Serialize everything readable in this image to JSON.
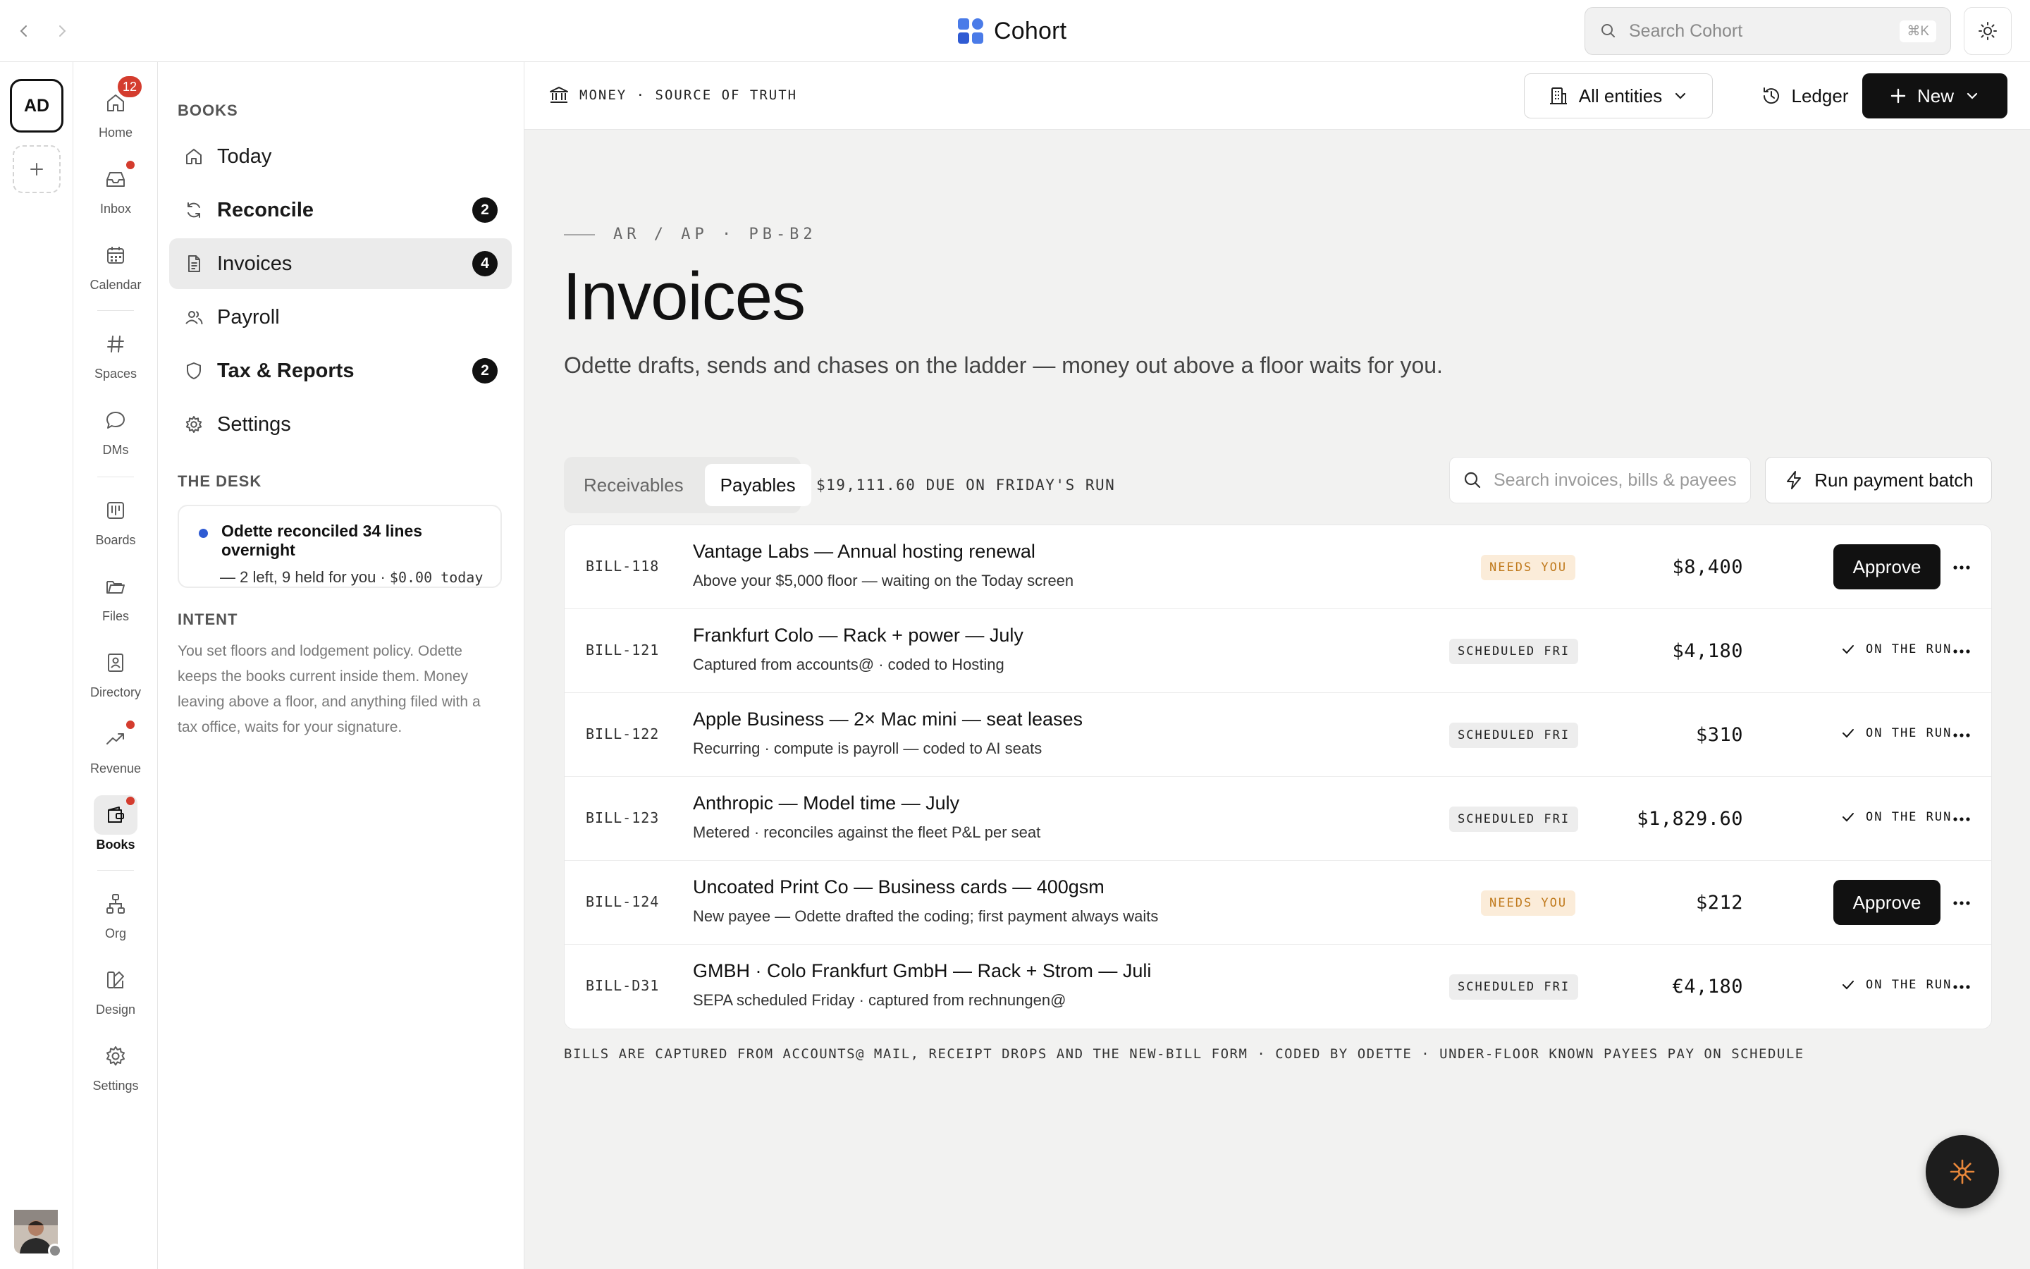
{
  "topbar": {
    "brand_name": "Cohort",
    "search_placeholder": "Search Cohort",
    "search_shortcut": "⌘K"
  },
  "workspace": {
    "initials": "AD"
  },
  "app_nav": [
    {
      "label": "Home",
      "icon": "home-icon",
      "count": "12"
    },
    {
      "label": "Inbox",
      "icon": "inbox-icon",
      "dot": true
    },
    {
      "label": "Calendar",
      "icon": "calendar-icon"
    },
    {
      "label": "Spaces",
      "icon": "hash-icon"
    },
    {
      "label": "DMs",
      "icon": "chat-bubble-icon"
    },
    {
      "label": "Boards",
      "icon": "board-icon"
    },
    {
      "label": "Files",
      "icon": "folder-icon"
    },
    {
      "label": "Directory",
      "icon": "contact-card-icon"
    },
    {
      "label": "Revenue",
      "icon": "trend-up-icon",
      "dot": true
    },
    {
      "label": "Books",
      "icon": "wallet-icon",
      "dot": true,
      "active": true
    },
    {
      "label": "Org",
      "icon": "org-chart-icon"
    },
    {
      "label": "Design",
      "icon": "design-icon"
    },
    {
      "label": "Settings",
      "icon": "gear-icon"
    }
  ],
  "sidebar": {
    "heading": "BOOKS",
    "items": [
      {
        "label": "Today",
        "icon": "home-icon"
      },
      {
        "label": "Reconcile",
        "icon": "refresh-icon",
        "badge": "2",
        "bold": true
      },
      {
        "label": "Invoices",
        "icon": "document-icon",
        "badge": "4",
        "active": true
      },
      {
        "label": "Payroll",
        "icon": "people-icon"
      },
      {
        "label": "Tax & Reports",
        "icon": "shield-icon",
        "badge": "2",
        "bold": true
      },
      {
        "label": "Settings",
        "icon": "gear-icon"
      }
    ],
    "desk_heading": "THE DESK",
    "desk_card": {
      "title": "Odette reconciled 34 lines overnight",
      "body": "— 2 left, 9 held for you · ",
      "amount": "$0.00 today"
    },
    "intent_heading": "INTENT",
    "intent_text": "You set floors and lodgement policy. Odette keeps the books current inside them. Money leaving above a floor, and anything filed with a tax office, waits for your signature."
  },
  "subheader": {
    "breadcrumb": "MONEY · SOURCE OF TRUTH",
    "entities_label": "All entities",
    "ledger_label": "Ledger",
    "new_label": "New"
  },
  "page": {
    "eyebrow": "AR / AP · PB-B2",
    "title": "Invoices",
    "subtitle": "Odette drafts, sends and chases on the ladder — money out above a floor waits for you."
  },
  "tabs": {
    "receivables": "Receivables",
    "payables": "Payables",
    "active": "Payables"
  },
  "due_text": "$19,111.60 DUE ON FRIDAY'S RUN",
  "table_search_placeholder": "Search invoices, bills & payees",
  "batch_label": "Run payment batch",
  "bills": [
    {
      "id": "BILL-118",
      "title": "Vantage Labs — Annual hosting renewal",
      "desc": "Above your $5,000 floor — waiting on the Today screen",
      "status": "NEEDS YOU",
      "amount": "$8,400",
      "action": "Approve"
    },
    {
      "id": "BILL-121",
      "title": "Frankfurt Colo — Rack + power — July",
      "desc": "Captured from accounts@ · coded to Hosting",
      "status": "SCHEDULED FRI",
      "amount": "$4,180",
      "action": "ON THE RUN"
    },
    {
      "id": "BILL-122",
      "title": "Apple Business — 2× Mac mini — seat leases",
      "desc": "Recurring · compute is payroll — coded to AI seats",
      "status": "SCHEDULED FRI",
      "amount": "$310",
      "action": "ON THE RUN"
    },
    {
      "id": "BILL-123",
      "title": "Anthropic — Model time — July",
      "desc": "Metered · reconciles against the fleet P&L per seat",
      "status": "SCHEDULED FRI",
      "amount": "$1,829.60",
      "action": "ON THE RUN"
    },
    {
      "id": "BILL-124",
      "title": "Uncoated Print Co — Business cards — 400gsm",
      "desc": "New payee — Odette drafted the coding; first payment always waits",
      "status": "NEEDS YOU",
      "amount": "$212",
      "action": "Approve"
    },
    {
      "id": "BILL-D31",
      "title": "GMBH · Colo Frankfurt GmbH — Rack + Strom — Juli",
      "desc": "SEPA scheduled Friday · captured from rechnungen@",
      "status": "SCHEDULED FRI",
      "amount": "€4,180",
      "action": "ON THE RUN"
    }
  ],
  "footnote": "BILLS ARE CAPTURED FROM ACCOUNTS@ MAIL, RECEIPT DROPS AND THE NEW-BILL FORM · CODED BY ODETTE · UNDER-FLOOR KNOWN PAYEES PAY ON SCHEDULE",
  "colors": {
    "accent_dark": "#111111",
    "badge_red": "#d43c2e",
    "needs_you_bg": "#fbecd9",
    "needs_you_text": "#c07a1d",
    "desk_dot": "#2f5bd3",
    "fab_star": "#e8873a"
  }
}
